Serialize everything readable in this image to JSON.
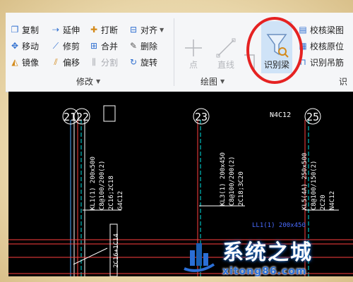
{
  "ribbon": {
    "modify": {
      "col1": [
        "复制",
        "移动",
        "镜像"
      ],
      "col2": [
        "延伸",
        "修剪",
        "偏移"
      ],
      "col3": [
        "打断",
        "合并",
        "分割"
      ],
      "col4": [
        "对齐",
        "删除",
        "旋转"
      ],
      "label": "修改"
    },
    "draw": {
      "point": "点",
      "line": "直线",
      "label": "绘图"
    },
    "identify": {
      "beam": "识别梁",
      "side": [
        "校核梁图",
        "校核原位",
        "识别吊筋"
      ],
      "label": "识"
    }
  },
  "canvas": {
    "axis": [
      "21",
      "22",
      "23",
      "25"
    ],
    "top_label": "N4C12",
    "beams": [
      [
        "KL1(1) 200x500",
        "C8@100/200(2)",
        "2C16;2C18",
        "G4C12"
      ],
      [
        "KL3(1) 200x450",
        "C8@100/200(2)",
        "2C18;3C20"
      ],
      [
        "KL5(4A) 250x500",
        "C8@100/150(2)",
        "2C20",
        "N4C12"
      ]
    ],
    "sub_label": "LL1(1) 200x450",
    "side_label": "2C16+1C14"
  },
  "watermark": {
    "title": "系统之城",
    "url": "xitong86.com"
  },
  "colors": {
    "highlight": "#e52222",
    "ribbon_active": "#cfe3f7",
    "canvas_bg": "#000000"
  }
}
